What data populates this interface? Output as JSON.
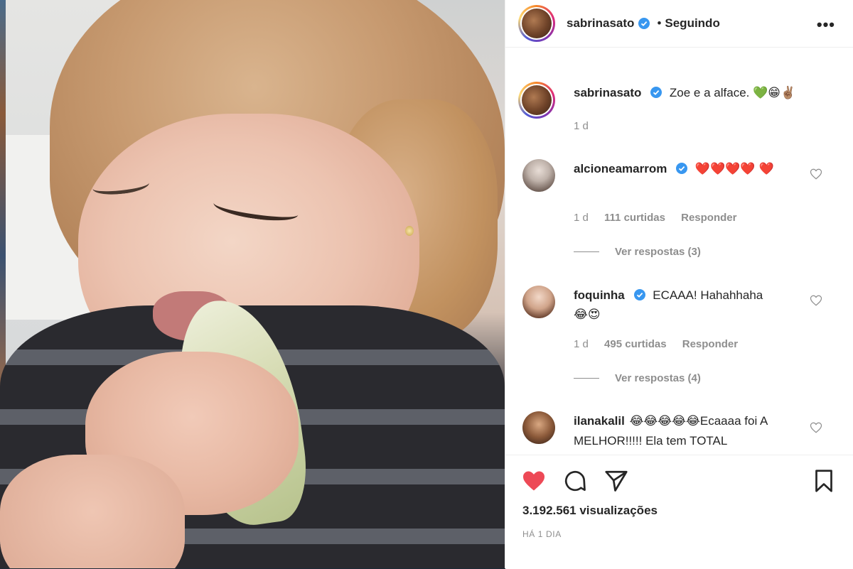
{
  "header": {
    "username": "sabrinasato",
    "separator": "•",
    "follow_status": "Seguindo",
    "more_icon": "•••"
  },
  "caption": {
    "username": "sabrinasato",
    "text": "Zoe e a alface.",
    "emojis": "💚😁✌🏽",
    "time": "1 d"
  },
  "comments": [
    {
      "username": "alcioneamarrom",
      "text": "",
      "emojis": "❤️❤️❤️❤️ ❤️",
      "time": "1 d",
      "likes": "111 curtidas",
      "reply_label": "Responder",
      "view_replies": "Ver respostas (3)"
    },
    {
      "username": "foquinha",
      "text": "ECAAA! Hahahhaha",
      "emojis": "😂😍",
      "time": "1 d",
      "likes": "495 curtidas",
      "reply_label": "Responder",
      "view_replies": "Ver respostas (4)"
    },
    {
      "username": "ilanakalil",
      "emojis": "😂😂😂😂😂",
      "text": "Ecaaaa foi A MELHOR!!!!! Ela tem TOTAL"
    }
  ],
  "actions": {
    "views": "3.192.561 visualizações",
    "posted": "HÁ 1 DIA",
    "icons": [
      "heart-icon",
      "comment-icon",
      "share-icon",
      "bookmark-icon"
    ]
  },
  "colors": {
    "liked_heart": "#ed4956",
    "verified_blue": "#3897f0",
    "muted_text": "#8e8e8e"
  }
}
